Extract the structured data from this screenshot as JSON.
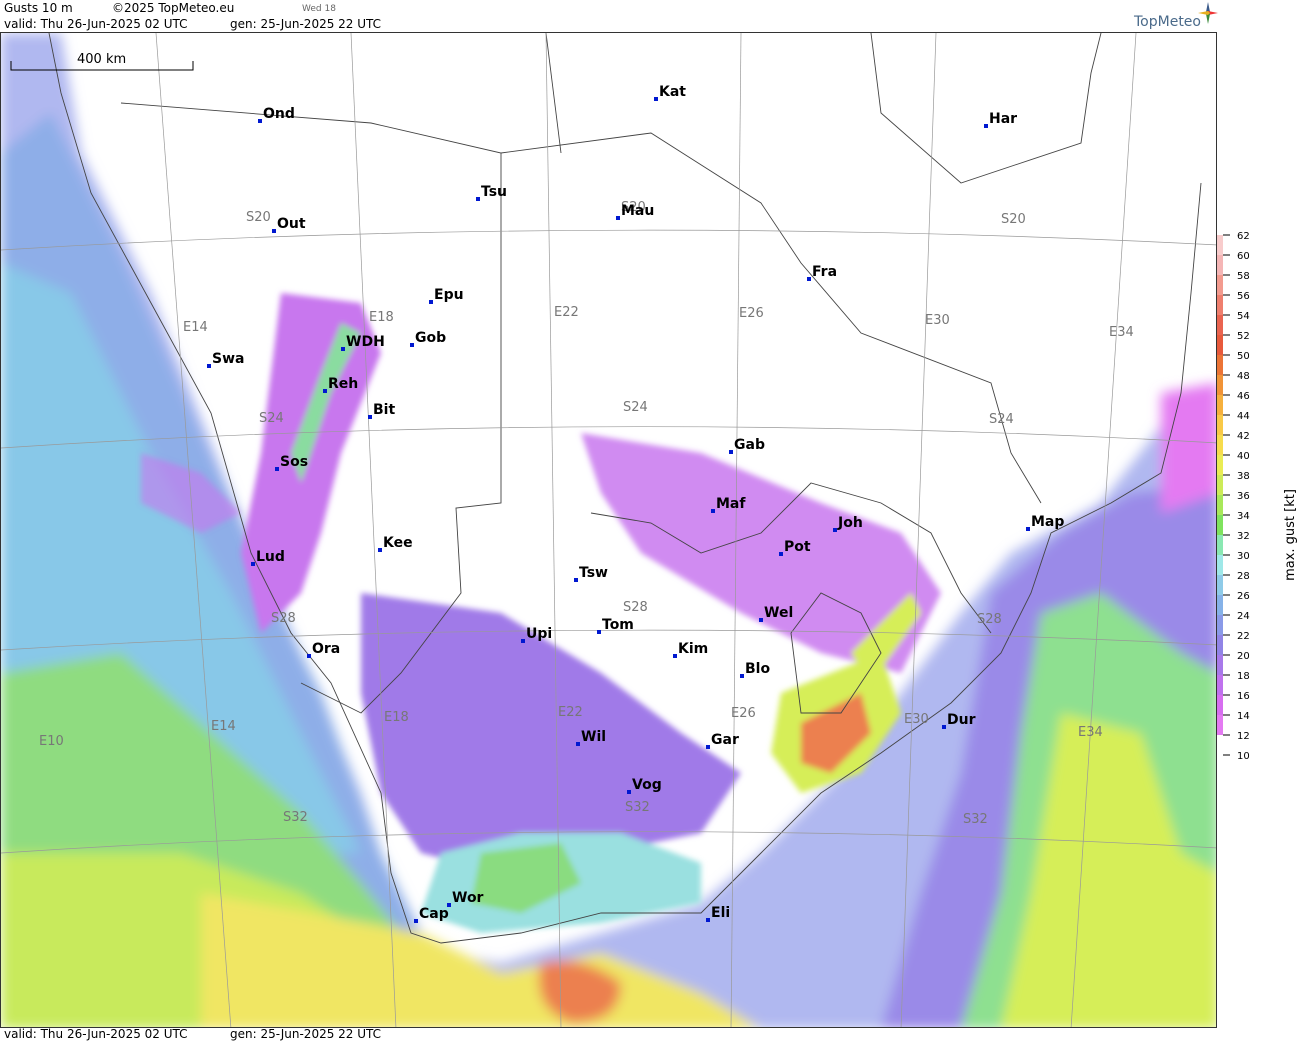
{
  "header": {
    "product": "Gusts 10 m",
    "copyright": "©2025 TopMeteo.eu",
    "small_day": "Wed 18",
    "valid": "valid:  Thu  26-Jun-2025  02 UTC",
    "gen": "gen: 25-Jun-2025 22 UTC",
    "brand": "TopMeteo"
  },
  "footer": {
    "valid": "valid:  Thu  26-Jun-2025  02 UTC",
    "gen": "gen: 25-Jun-2025 22 UTC"
  },
  "scale_bar": {
    "label": "400 km"
  },
  "legend": {
    "title": "max. gust  [kt]",
    "entries": [
      {
        "value": "62",
        "color": "#fbe3e3"
      },
      {
        "value": "60",
        "color": "#f8cccc"
      },
      {
        "value": "58",
        "color": "#f5b6b6"
      },
      {
        "value": "56",
        "color": "#f39b8f"
      },
      {
        "value": "54",
        "color": "#ef7f6e"
      },
      {
        "value": "52",
        "color": "#ea6450"
      },
      {
        "value": "50",
        "color": "#e85a3c"
      },
      {
        "value": "48",
        "color": "#ec7436"
      },
      {
        "value": "46",
        "color": "#f19337"
      },
      {
        "value": "44",
        "color": "#f6b03d"
      },
      {
        "value": "42",
        "color": "#f9c947"
      },
      {
        "value": "40",
        "color": "#f7dc4d"
      },
      {
        "value": "38",
        "color": "#eaec54"
      },
      {
        "value": "36",
        "color": "#cdeb58"
      },
      {
        "value": "34",
        "color": "#a8e85a"
      },
      {
        "value": "32",
        "color": "#7fe35e"
      },
      {
        "value": "30",
        "color": "#8ae8b2"
      },
      {
        "value": "28",
        "color": "#9fe8e8"
      },
      {
        "value": "26",
        "color": "#8fcbe8"
      },
      {
        "value": "24",
        "color": "#86b2e8"
      },
      {
        "value": "22",
        "color": "#8a9ae8"
      },
      {
        "value": "20",
        "color": "#9184e6"
      },
      {
        "value": "18",
        "color": "#a879ea"
      },
      {
        "value": "16",
        "color": "#c072ee"
      },
      {
        "value": "14",
        "color": "#d76ef0"
      },
      {
        "value": "12",
        "color": "#e47af2"
      },
      {
        "value": "10",
        "color": "#ffffff"
      }
    ]
  },
  "grid_labels": [
    {
      "text": "S20"
    },
    {
      "text": "S20"
    },
    {
      "text": "S20"
    },
    {
      "text": "S24"
    },
    {
      "text": "S24"
    },
    {
      "text": "S24"
    },
    {
      "text": "S28"
    },
    {
      "text": "S28"
    },
    {
      "text": "S28"
    },
    {
      "text": "S32"
    },
    {
      "text": "S32"
    },
    {
      "text": "S32"
    },
    {
      "text": "E14"
    },
    {
      "text": "E18"
    },
    {
      "text": "E22"
    },
    {
      "text": "E26"
    },
    {
      "text": "E30"
    },
    {
      "text": "E34"
    },
    {
      "text": "E10"
    },
    {
      "text": "E14"
    },
    {
      "text": "E18"
    },
    {
      "text": "E22"
    },
    {
      "text": "E26"
    },
    {
      "text": "E30"
    },
    {
      "text": "E34"
    }
  ],
  "cities": [
    {
      "name": "Kat"
    },
    {
      "name": "Ond"
    },
    {
      "name": "Har"
    },
    {
      "name": "Tsu"
    },
    {
      "name": "Mau"
    },
    {
      "name": "Out"
    },
    {
      "name": "Fra"
    },
    {
      "name": "Epu"
    },
    {
      "name": "Gob"
    },
    {
      "name": "WDH"
    },
    {
      "name": "Swa"
    },
    {
      "name": "Reh"
    },
    {
      "name": "Bit"
    },
    {
      "name": "Gab"
    },
    {
      "name": "Sos"
    },
    {
      "name": "Maf"
    },
    {
      "name": "Joh"
    },
    {
      "name": "Map"
    },
    {
      "name": "Kee"
    },
    {
      "name": "Pot"
    },
    {
      "name": "Lud"
    },
    {
      "name": "Tsw"
    },
    {
      "name": "Wel"
    },
    {
      "name": "Upi"
    },
    {
      "name": "Tom"
    },
    {
      "name": "Kim"
    },
    {
      "name": "Ora"
    },
    {
      "name": "Blo"
    },
    {
      "name": "Dur"
    },
    {
      "name": "Wil"
    },
    {
      "name": "Gar"
    },
    {
      "name": "Vog"
    },
    {
      "name": "Wor"
    },
    {
      "name": "Cap"
    },
    {
      "name": "Eli"
    }
  ]
}
